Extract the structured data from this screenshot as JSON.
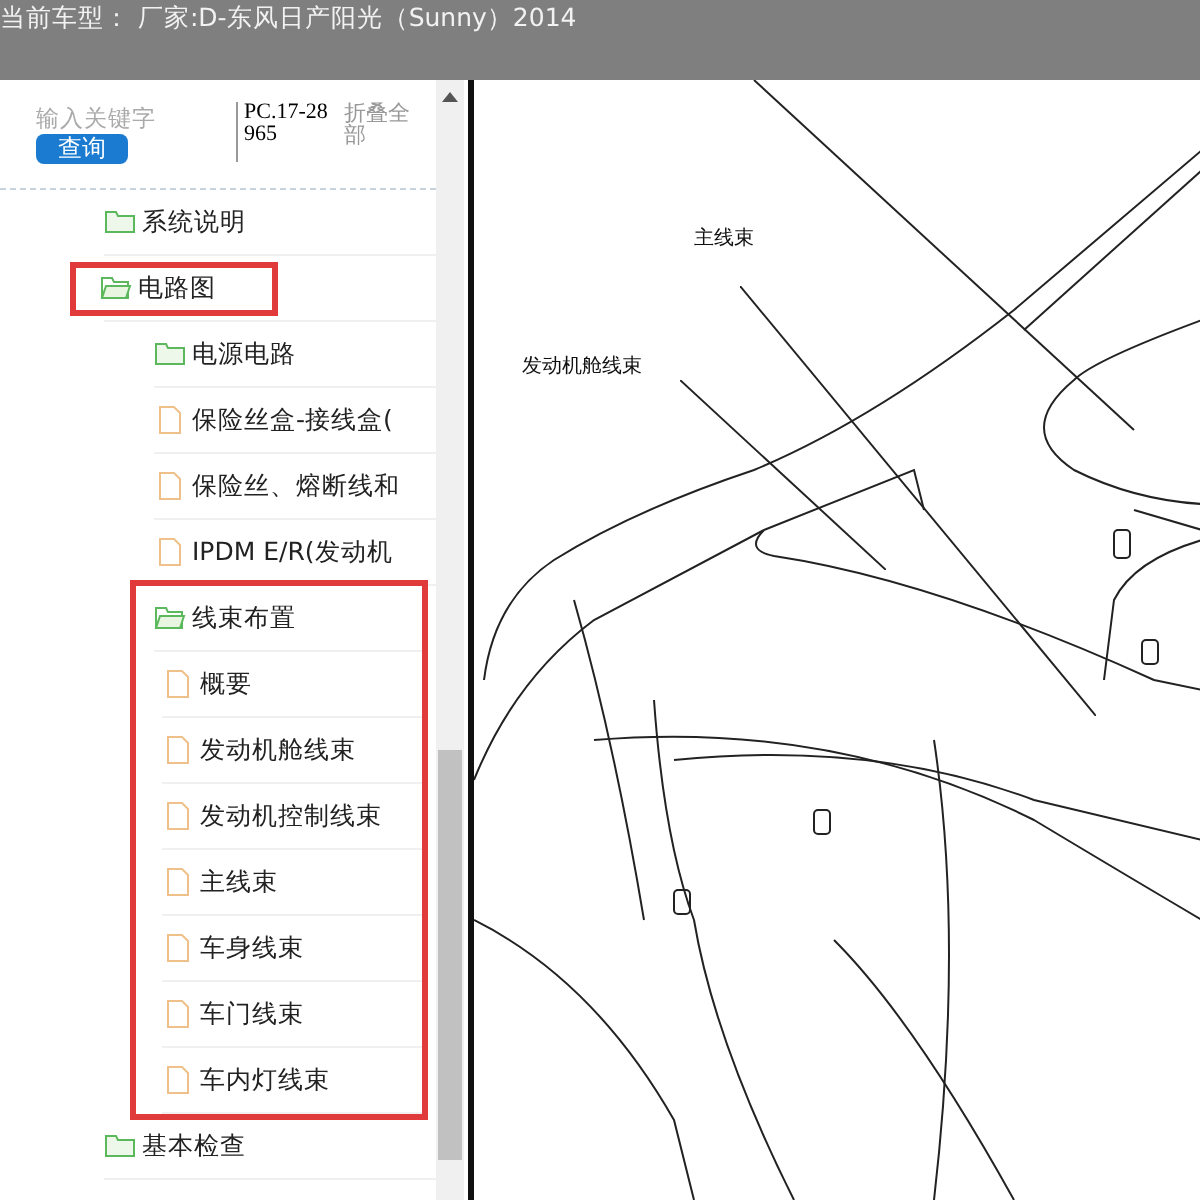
{
  "header": {
    "title": "当前车型： 厂家:D-东风日产阳光（Sunny）2014"
  },
  "search": {
    "placeholder": "输入关键字",
    "button": "查询",
    "code": "PC.17-28965",
    "collapse": "折叠全部"
  },
  "tree": [
    {
      "label": "系统说明",
      "kind": "folder",
      "expanded": false,
      "highlighted": false
    },
    {
      "label": "电路图",
      "kind": "folder",
      "expanded": true,
      "highlighted": true,
      "highlight_group": false,
      "children": [
        {
          "label": "电源电路",
          "kind": "folder",
          "expanded": false,
          "highlighted": false
        },
        {
          "label": "保险丝盒-接线盒(",
          "kind": "file",
          "highlighted": false
        },
        {
          "label": "保险丝、熔断线和",
          "kind": "file",
          "highlighted": false
        },
        {
          "label": "IPDM E/R(发动机",
          "kind": "file",
          "highlighted": false
        },
        {
          "label": "线束布置",
          "kind": "folder",
          "expanded": true,
          "highlighted": true,
          "highlight_group": true,
          "children": [
            {
              "label": "概要",
              "kind": "file",
              "highlighted": false
            },
            {
              "label": "发动机舱线束",
              "kind": "file",
              "highlighted": false
            },
            {
              "label": "发动机控制线束",
              "kind": "file",
              "highlighted": false
            },
            {
              "label": "主线束",
              "kind": "file",
              "highlighted": false
            },
            {
              "label": "车身线束",
              "kind": "file",
              "highlighted": false
            },
            {
              "label": "车门线束",
              "kind": "file",
              "highlighted": false
            },
            {
              "label": "车内灯线束",
              "kind": "file",
              "highlighted": false
            }
          ]
        }
      ]
    },
    {
      "label": "基本检查",
      "kind": "folder",
      "expanded": false,
      "highlighted": false
    }
  ],
  "diagram": {
    "labels": [
      "主线束",
      "发动机舱线束"
    ]
  }
}
